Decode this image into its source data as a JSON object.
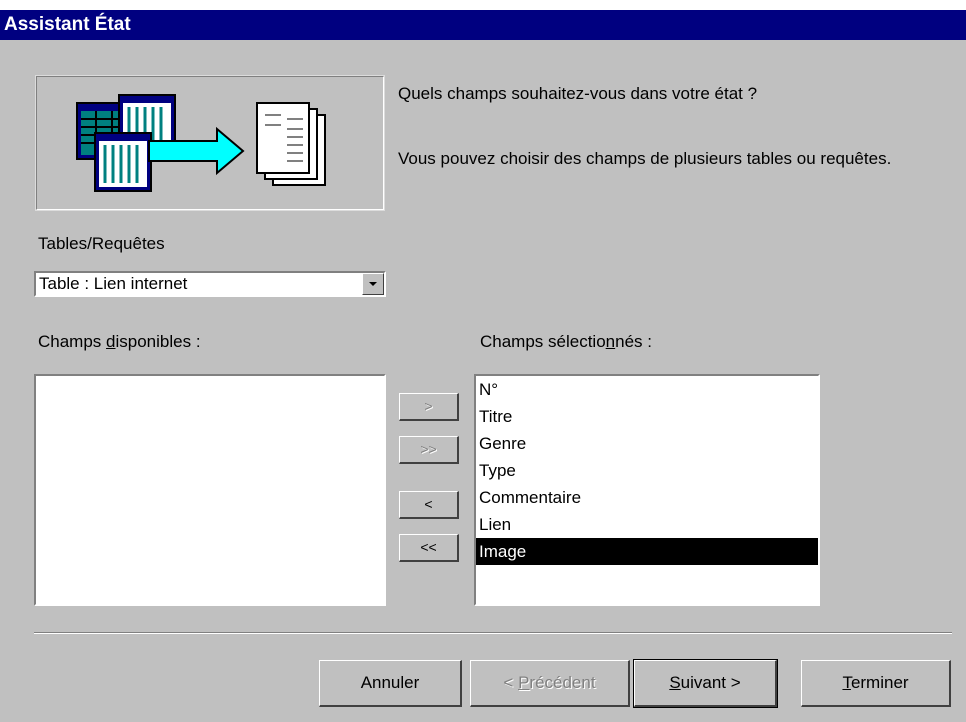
{
  "window": {
    "title": "Assistant État"
  },
  "intro": {
    "question": "Quels champs souhaitez-vous dans votre état ?",
    "hint": "Vous pouvez choisir des champs de plusieurs tables ou requêtes."
  },
  "tables": {
    "label": "Tables/Requêtes",
    "selected": "Table : Lien internet"
  },
  "available": {
    "label_pre": "Champs ",
    "label_u": "d",
    "label_post": "isponibles :",
    "items": []
  },
  "selected": {
    "label_pre": "Champs sélectio",
    "label_u": "n",
    "label_post": "nés :",
    "items": [
      "N°",
      "Titre",
      "Genre",
      "Type",
      "Commentaire",
      "Lien",
      "Image"
    ],
    "highlighted": "Image"
  },
  "move_buttons": {
    "add_one": ">",
    "add_all": ">>",
    "remove_one": "<",
    "remove_all": "<<"
  },
  "buttons": {
    "cancel": "Annuler",
    "back_pre": "< ",
    "back_u": "P",
    "back_post": "récédent",
    "next_u": "S",
    "next_post": "uivant >",
    "finish_u": "T",
    "finish_post": "erminer"
  },
  "icons": {
    "wizard_illustration": "tables-to-report-illustration",
    "dropdown": "chevron-down-icon"
  },
  "colors": {
    "titlebar": "#000080",
    "dialog": "#c0c0c0",
    "selection": "#000000",
    "arrow": "#00ffff"
  }
}
